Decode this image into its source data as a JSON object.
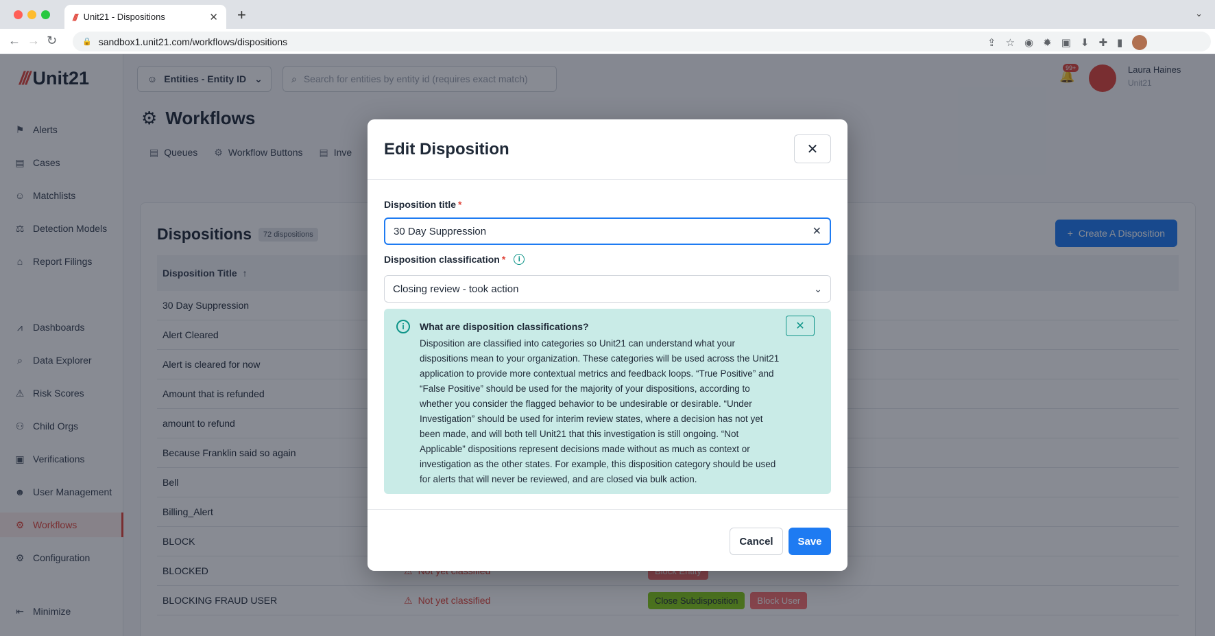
{
  "browser": {
    "tab_title": "Unit21 - Dispositions",
    "url": "sandbox1.unit21.com/workflows/dispositions"
  },
  "app": {
    "logo_text": "Unit21",
    "entity_selector": "Entities - Entity ID",
    "search_placeholder": "Search for entities by entity id (requires exact match)",
    "notif_count": "99+",
    "user_name": "Laura Haines",
    "user_org": "Unit21"
  },
  "sidebar": {
    "items": [
      {
        "label": "Alerts",
        "icon": "flag-icon"
      },
      {
        "label": "Cases",
        "icon": "briefcase-icon"
      },
      {
        "label": "Matchlists",
        "icon": "user-x-icon"
      },
      {
        "label": "Detection Models",
        "icon": "scale-icon"
      },
      {
        "label": "Report Filings",
        "icon": "bank-icon"
      },
      {
        "label": "Dashboards",
        "icon": "chart-line-icon"
      },
      {
        "label": "Data Explorer",
        "icon": "search-list-icon"
      },
      {
        "label": "Risk Scores",
        "icon": "warning-icon"
      },
      {
        "label": "Child Orgs",
        "icon": "hierarchy-icon"
      },
      {
        "label": "Verifications",
        "icon": "id-card-icon"
      },
      {
        "label": "User Management",
        "icon": "users-icon"
      },
      {
        "label": "Workflows",
        "icon": "gear-icon"
      },
      {
        "label": "Configuration",
        "icon": "cog-icon"
      }
    ],
    "minimize": "Minimize"
  },
  "page": {
    "title": "Workflows",
    "subtabs": [
      "Queues",
      "Workflow Buttons",
      "Inve"
    ]
  },
  "panel": {
    "title": "Dispositions",
    "count": "72 dispositions",
    "create_label": "Create A Disposition",
    "column_title": "Disposition Title",
    "rows": [
      {
        "title": "30 Day Suppression"
      },
      {
        "title": "Alert Cleared"
      },
      {
        "title": "Alert is cleared for now"
      },
      {
        "title": "Amount that is refunded"
      },
      {
        "title": "amount to refund"
      },
      {
        "title": "Because Franklin said so again"
      },
      {
        "title": "Bell"
      },
      {
        "title": "Billing_Alert"
      },
      {
        "title": "BLOCK"
      },
      {
        "title": "BLOCKED",
        "class": "Not yet classified",
        "buttons": [
          {
            "label": "Block Entity",
            "color": "red"
          }
        ]
      },
      {
        "title": "BLOCKING FRAUD USER",
        "class": "Not yet classified",
        "buttons": [
          {
            "label": "Close Subdisposition",
            "color": "green"
          },
          {
            "label": "Block User",
            "color": "red"
          }
        ]
      }
    ]
  },
  "modal": {
    "title": "Edit Disposition",
    "title_label": "Disposition title",
    "title_value": "30 Day Suppression",
    "class_label": "Disposition classification",
    "class_value": "Closing review - took action",
    "info_title": "What are disposition classifications?",
    "info_body": "Disposition are classified into categories so Unit21 can understand what your dispositions mean to your organization. These categories will be used across the Unit21 application to provide more contextual metrics and feedback loops. “True Positive” and “False Positive” should be used for the majority of your dispositions, according to whether you consider the flagged behavior to be undesirable or desirable. “Under Investigation” should be used for interim review states, where a decision has not yet been made, and will both tell Unit21 that this investigation is still ongoing. “Not Applicable” dispositions represent decisions made without as much as context or investigation as the other states. For example, this disposition category should be used for alerts that will never be reviewed, and are closed via bulk action.",
    "cancel_label": "Cancel",
    "save_label": "Save"
  },
  "colors": {
    "accent": "#1e7bf2",
    "brand": "#e0453a",
    "info_bg": "#c9ebe7"
  }
}
